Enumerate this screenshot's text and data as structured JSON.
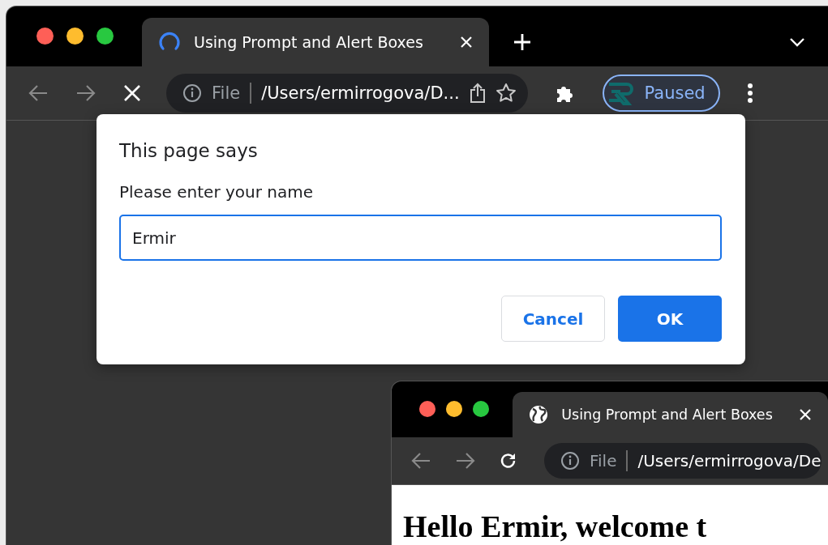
{
  "main_window": {
    "tab": {
      "title": "Using Prompt and Alert Boxes",
      "loading": true
    },
    "address": {
      "scheme": "File",
      "url": "/Users/ermirrogova/D..."
    },
    "profile": {
      "label": "Paused"
    }
  },
  "dialog": {
    "title": "This page says",
    "message": "Please enter your name",
    "value": "Ermir",
    "buttons": [
      {
        "label": "Cancel",
        "kind": "secondary"
      },
      {
        "label": "OK",
        "kind": "primary"
      }
    ]
  },
  "second_window": {
    "tab": {
      "title": "Using Prompt and Alert Boxes",
      "loading": false
    },
    "address": {
      "scheme": "File",
      "url": "/Users/ermirrogova/De"
    },
    "heading": "Hello Ermir, welcome t"
  }
}
